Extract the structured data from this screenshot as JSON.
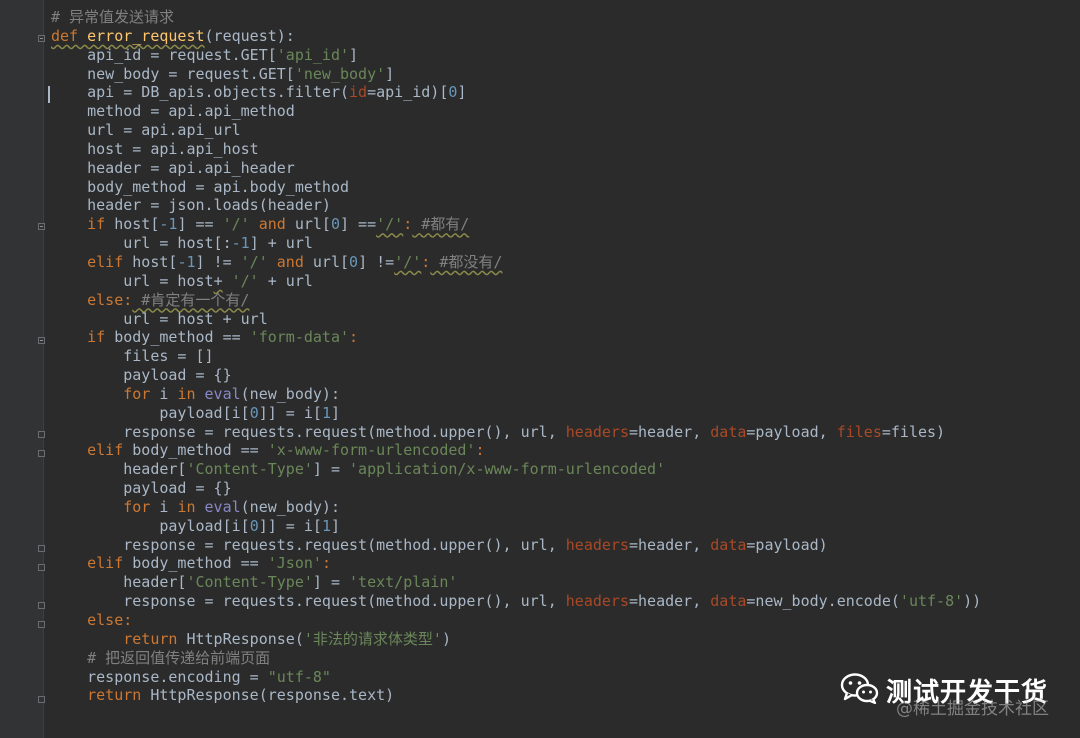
{
  "colors": {
    "background": "#2b2b2b",
    "keyword": "#cc7832",
    "string": "#6a8759",
    "comment": "#808080",
    "function": "#ffc66d",
    "number": "#6897bb",
    "parameter": "#aa4926",
    "builtin": "#8888c6",
    "text": "#a9b7c6"
  },
  "code_lines": [
    [
      [
        "# 异常值发送请求",
        "cmt"
      ]
    ],
    [
      [
        "def",
        "kw ul"
      ],
      [
        " ",
        "ul"
      ],
      [
        "error_request",
        "fn ul"
      ],
      [
        "(request):",
        ""
      ]
    ],
    [
      [
        "    api_id = request.GET[",
        ""
      ],
      [
        "'api_id'",
        "str"
      ],
      [
        "]",
        ""
      ]
    ],
    [
      [
        "    new_body = request.GET[",
        ""
      ],
      [
        "'new_body'",
        "str"
      ],
      [
        "]",
        ""
      ]
    ],
    [
      [
        "    api = DB_apis.objects.filter(",
        ""
      ],
      [
        "id",
        "param"
      ],
      [
        "=api_id)[",
        ""
      ],
      [
        "0",
        "num"
      ],
      [
        "]",
        ""
      ]
    ],
    [
      [
        "    method = api.api_method",
        ""
      ]
    ],
    [
      [
        "    url = api.api_url",
        ""
      ]
    ],
    [
      [
        "    host = api.api_host",
        ""
      ]
    ],
    [
      [
        "    header = api.api_header",
        ""
      ]
    ],
    [
      [
        "    body_method = api.body_method",
        ""
      ]
    ],
    [
      [
        "    header = json.loads(header)",
        ""
      ]
    ],
    [
      [
        "    ",
        ""
      ],
      [
        "if",
        "kw"
      ],
      [
        " host[",
        ""
      ],
      [
        "-1",
        "num"
      ],
      [
        "] == ",
        ""
      ],
      [
        "'/'",
        "str"
      ],
      [
        " ",
        ""
      ],
      [
        "and",
        "kw"
      ],
      [
        " url[",
        ""
      ],
      [
        "0",
        "num"
      ],
      [
        "] ==",
        ""
      ],
      [
        "'/'",
        "str ul"
      ],
      [
        ":",
        "kw"
      ],
      [
        " #都有/",
        "cmt ul"
      ]
    ],
    [
      [
        "        url = host[:",
        ""
      ],
      [
        "-1",
        "num"
      ],
      [
        "] + url",
        ""
      ]
    ],
    [
      [
        "    ",
        ""
      ],
      [
        "elif",
        "kw"
      ],
      [
        " host[",
        ""
      ],
      [
        "-1",
        "num"
      ],
      [
        "] != ",
        ""
      ],
      [
        "'/'",
        "str"
      ],
      [
        " ",
        ""
      ],
      [
        "and",
        "kw"
      ],
      [
        " url[",
        ""
      ],
      [
        "0",
        "num"
      ],
      [
        "] !=",
        ""
      ],
      [
        "'/'",
        "str ul"
      ],
      [
        ":",
        "kw"
      ],
      [
        " #都没有/",
        "cmt ul"
      ]
    ],
    [
      [
        "        url = host",
        ""
      ],
      [
        "+",
        "ul"
      ],
      [
        " ",
        ""
      ],
      [
        "'/'",
        "str"
      ],
      [
        " + url",
        ""
      ]
    ],
    [
      [
        "    ",
        ""
      ],
      [
        "else",
        "kw"
      ],
      [
        ":",
        "kw"
      ],
      [
        " #肯定有一个有/",
        "cmt ul"
      ]
    ],
    [
      [
        "        url = host + url",
        ""
      ]
    ],
    [
      [
        "    ",
        ""
      ],
      [
        "if",
        "kw"
      ],
      [
        " body_method == ",
        ""
      ],
      [
        "'form-data'",
        "str"
      ],
      [
        ":",
        "kw"
      ]
    ],
    [
      [
        "        files = []",
        ""
      ]
    ],
    [
      [
        "        payload = {}",
        ""
      ]
    ],
    [
      [
        "        ",
        ""
      ],
      [
        "for",
        "kw"
      ],
      [
        " i ",
        ""
      ],
      [
        "in",
        "kw"
      ],
      [
        " ",
        ""
      ],
      [
        "eval",
        "bi"
      ],
      [
        "(new_body):",
        ""
      ]
    ],
    [
      [
        "            payload[i[",
        ""
      ],
      [
        "0",
        "num"
      ],
      [
        "]] = i[",
        ""
      ],
      [
        "1",
        "num"
      ],
      [
        "]",
        ""
      ]
    ],
    [
      [
        "        response = requests.request(method.upper(), url, ",
        ""
      ],
      [
        "headers",
        "param"
      ],
      [
        "=header, ",
        ""
      ],
      [
        "data",
        "param"
      ],
      [
        "=payload, ",
        ""
      ],
      [
        "files",
        "param"
      ],
      [
        "=files)",
        ""
      ]
    ],
    [
      [
        "    ",
        ""
      ],
      [
        "elif",
        "kw"
      ],
      [
        " body_method == ",
        ""
      ],
      [
        "'x-www-form-urlencoded'",
        "str"
      ],
      [
        ":",
        "kw"
      ]
    ],
    [
      [
        "        header[",
        ""
      ],
      [
        "'Content-Type'",
        "str"
      ],
      [
        "] = ",
        ""
      ],
      [
        "'application/x-www-form-urlencoded'",
        "str"
      ]
    ],
    [
      [
        "        payload = {}",
        ""
      ]
    ],
    [
      [
        "        ",
        ""
      ],
      [
        "for",
        "kw"
      ],
      [
        " i ",
        ""
      ],
      [
        "in",
        "kw"
      ],
      [
        " ",
        ""
      ],
      [
        "eval",
        "bi"
      ],
      [
        "(new_body):",
        ""
      ]
    ],
    [
      [
        "            payload[i[",
        ""
      ],
      [
        "0",
        "num"
      ],
      [
        "]] = i[",
        ""
      ],
      [
        "1",
        "num"
      ],
      [
        "]",
        ""
      ]
    ],
    [
      [
        "        response = requests.request(method.upper(), url, ",
        ""
      ],
      [
        "headers",
        "param"
      ],
      [
        "=header, ",
        ""
      ],
      [
        "data",
        "param"
      ],
      [
        "=payload)",
        ""
      ]
    ],
    [
      [
        "    ",
        ""
      ],
      [
        "elif",
        "kw"
      ],
      [
        " body_method == ",
        ""
      ],
      [
        "'Json'",
        "str"
      ],
      [
        ":",
        "kw"
      ]
    ],
    [
      [
        "        header[",
        ""
      ],
      [
        "'Content-Type'",
        "str"
      ],
      [
        "] = ",
        ""
      ],
      [
        "'text/plain'",
        "str"
      ]
    ],
    [
      [
        "        response = requests.request(method.upper(), url, ",
        ""
      ],
      [
        "headers",
        "param"
      ],
      [
        "=header, ",
        ""
      ],
      [
        "data",
        "param"
      ],
      [
        "=new_body.encode(",
        ""
      ],
      [
        "'utf-8'",
        "str"
      ],
      [
        "))",
        ""
      ]
    ],
    [
      [
        "    ",
        ""
      ],
      [
        "else",
        "kw"
      ],
      [
        ":",
        "kw"
      ]
    ],
    [
      [
        "        ",
        ""
      ],
      [
        "return",
        "kw"
      ],
      [
        " HttpResponse(",
        ""
      ],
      [
        "'非法的请求体类型'",
        "str"
      ],
      [
        ")",
        ""
      ]
    ],
    [
      [
        "    # 把返回值传递给前端页面",
        "cmt"
      ]
    ],
    [
      [
        "    response.encoding = ",
        ""
      ],
      [
        "\"utf-8\"",
        "str"
      ]
    ],
    [
      [
        "    ",
        ""
      ],
      [
        "return",
        "kw"
      ],
      [
        " HttpResponse(response.text)",
        ""
      ]
    ]
  ],
  "watermark": {
    "title": "测试开发干货",
    "subtitle": "@稀土掘金技术社区",
    "icon": "wechat-icon"
  }
}
